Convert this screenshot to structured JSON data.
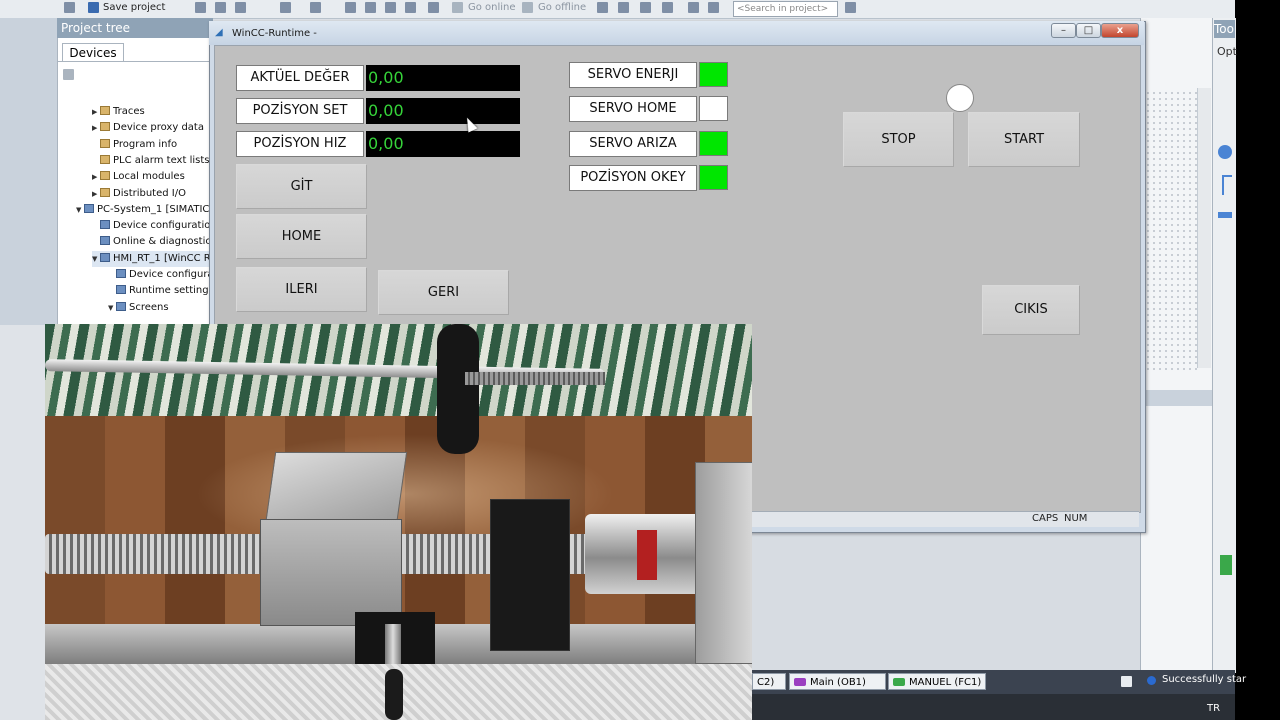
{
  "toolbar": {
    "save_project": "Save project",
    "go_online": "Go online",
    "go_offline": "Go offline",
    "search_placeholder": "<Search in project>"
  },
  "project_tree": {
    "title": "Project tree",
    "tab": "Devices",
    "items": [
      {
        "label": "Traces",
        "indent": 2,
        "arrow": "▶"
      },
      {
        "label": "Device proxy data",
        "indent": 2,
        "arrow": "▶"
      },
      {
        "label": "Program info",
        "indent": 2,
        "arrow": ""
      },
      {
        "label": "PLC alarm text lists",
        "indent": 2,
        "arrow": ""
      },
      {
        "label": "Local modules",
        "indent": 2,
        "arrow": "▶"
      },
      {
        "label": "Distributed I/O",
        "indent": 2,
        "arrow": "▶"
      },
      {
        "label": "PC-System_1 [SIMATIC",
        "indent": 1,
        "arrow": "▼"
      },
      {
        "label": "Device configuration",
        "indent": 2,
        "arrow": ""
      },
      {
        "label": "Online & diagnostics",
        "indent": 2,
        "arrow": ""
      },
      {
        "label": "HMI_RT_1 [WinCC R",
        "indent": 2,
        "arrow": "▼"
      },
      {
        "label": "Device configuration",
        "indent": 3,
        "arrow": ""
      },
      {
        "label": "Runtime settings",
        "indent": 3,
        "arrow": ""
      },
      {
        "label": "Screens",
        "indent": 3,
        "arrow": "▼"
      }
    ]
  },
  "right_panel": {
    "tools_title": "Tools",
    "options": "Opt"
  },
  "wincc": {
    "title": "WinCC-Runtime -",
    "min_btn": "–",
    "max_btn": "□",
    "close_btn": "x",
    "status_caps": "CAPS",
    "status_num": "NUM"
  },
  "hmi": {
    "aktuel_label": "AKTÜEL DEĞER",
    "aktuel_value": "0,00",
    "pozisyon_set_label": "POZİSYON SET",
    "pozisyon_set_value": "0,00",
    "pozisyon_hiz_label": "POZİSYON HIZ",
    "pozisyon_hiz_value": "0,00",
    "git_btn": "GİT",
    "home_btn": "HOME",
    "ileri_btn": "ILERI",
    "geri_btn": "GERI",
    "servo_enerji_label": "SERVO ENERJI",
    "servo_home_label": "SERVO HOME",
    "servo_ariza_label": "SERVO ARIZA",
    "pozisyon_okey_label": "POZİSYON OKEY",
    "stop_btn": "STOP",
    "start_btn": "START",
    "cikis_btn": "CIKIS",
    "indicator_colors": {
      "servo_enerji": "#00e600",
      "servo_home": "#ffffff",
      "servo_ariza": "#00e600",
      "pozisyon_okey": "#00e600"
    }
  },
  "taskbar": {
    "item_1": "C2)",
    "item_2": "Main (OB1)",
    "item_3": "MANUEL (FC1)",
    "status": "Successfully star",
    "lang": "TR"
  }
}
